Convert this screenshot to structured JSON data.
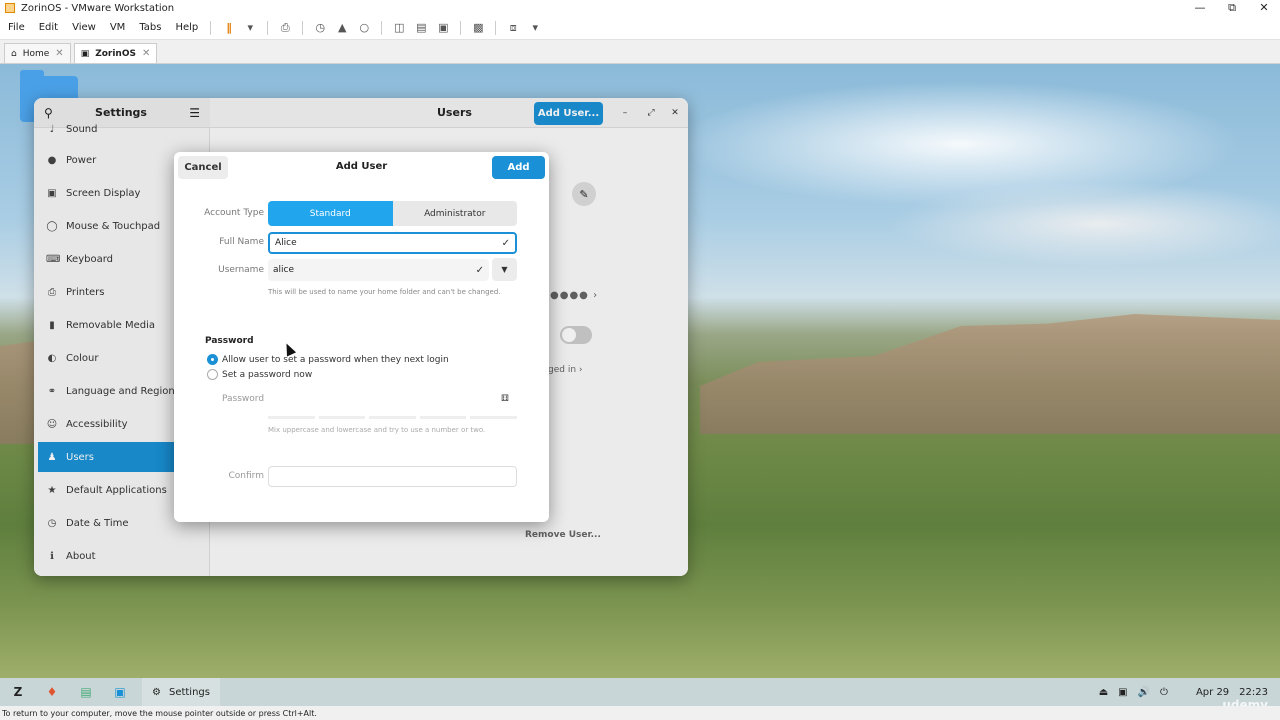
{
  "vmware": {
    "window_title": "ZorinOS - VMware Workstation",
    "menu": [
      "File",
      "Edit",
      "View",
      "VM",
      "Tabs",
      "Help"
    ],
    "tabs": [
      {
        "label": "Home"
      },
      {
        "label": "ZorinOS"
      }
    ],
    "status_text": "To return to your computer, move the mouse pointer outside or press Ctrl+Alt."
  },
  "settings": {
    "sidebar_title": "Settings",
    "main_title": "Users",
    "add_user_button": "Add User...",
    "sidebar_items": [
      {
        "label": "Sound",
        "icon": "speaker-icon"
      },
      {
        "label": "Power",
        "icon": "power-icon"
      },
      {
        "label": "Screen Display",
        "icon": "display-icon"
      },
      {
        "label": "Mouse & Touchpad",
        "icon": "mouse-icon"
      },
      {
        "label": "Keyboard",
        "icon": "keyboard-icon"
      },
      {
        "label": "Printers",
        "icon": "printer-icon"
      },
      {
        "label": "Removable Media",
        "icon": "usb-icon"
      },
      {
        "label": "Colour",
        "icon": "colour-icon"
      },
      {
        "label": "Language and Region",
        "icon": "globe-icon"
      },
      {
        "label": "Accessibility",
        "icon": "accessibility-icon"
      },
      {
        "label": "Users",
        "icon": "users-icon",
        "active": true
      },
      {
        "label": "Default Applications",
        "icon": "star-icon"
      },
      {
        "label": "Date & Time",
        "icon": "clock-icon"
      },
      {
        "label": "About",
        "icon": "info-icon"
      }
    ],
    "background_logged_text": "ged in",
    "remove_user": "Remove User..."
  },
  "dialog": {
    "title": "Add User",
    "cancel": "Cancel",
    "add": "Add",
    "account_type_label": "Account Type",
    "account_types": [
      "Standard",
      "Administrator"
    ],
    "selected_account_type": "Standard",
    "full_name_label": "Full Name",
    "full_name_value": "Alice",
    "username_label": "Username",
    "username_value": "alice",
    "username_hint": "This will be used to name your home folder and can't be changed.",
    "password_section": "Password",
    "password_options": [
      {
        "label": "Allow user to set a password when they next login",
        "selected": true
      },
      {
        "label": "Set a password now",
        "selected": false
      }
    ],
    "password_label": "Password",
    "password_hint": "Mix uppercase and lowercase and try to use a number or two.",
    "confirm_label": "Confirm"
  },
  "taskbar": {
    "active_app": "Settings",
    "date": "Apr 29",
    "time": "22:23"
  },
  "watermark": "udemy",
  "colors": {
    "accent": "#1a91d6",
    "segment_selected": "#21a6ee"
  }
}
